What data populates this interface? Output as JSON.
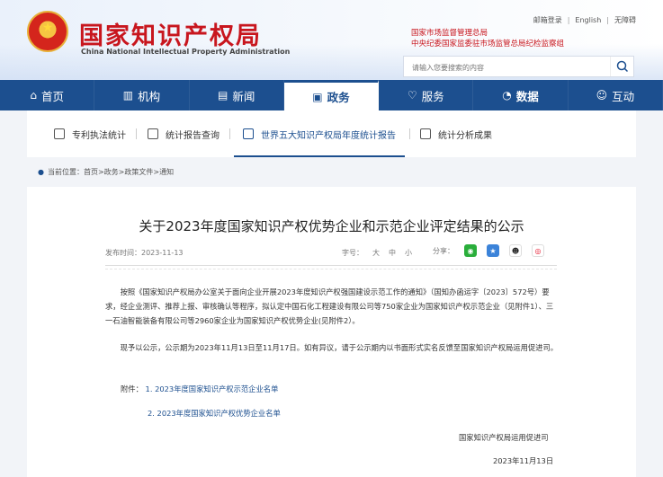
{
  "header": {
    "brand_cn": "国家知识产权局",
    "brand_en": "China National Intellectual Property Administration",
    "top_links": [
      "邮箱登录",
      "English",
      "无障碍"
    ],
    "org_links": [
      "国家市场监督管理总局",
      "中央纪委国家监委驻市场监管总局纪检监察组"
    ],
    "search_placeholder": "请输入您要搜索的内容"
  },
  "nav": [
    {
      "label": "首页",
      "icon": "home-icon"
    },
    {
      "label": "机构",
      "icon": "building-icon"
    },
    {
      "label": "新闻",
      "icon": "news-icon"
    },
    {
      "label": "政务",
      "icon": "document-icon",
      "active": true
    },
    {
      "label": "服务",
      "icon": "service-icon"
    },
    {
      "label": "数据",
      "icon": "chart-icon"
    },
    {
      "label": "互动",
      "icon": "interaction-icon"
    }
  ],
  "subnav": [
    {
      "label": "专利执法统计"
    },
    {
      "label": "统计报告查询"
    },
    {
      "label": "世界五大知识产权局年度统计报告",
      "active": true
    },
    {
      "label": "统计分析成果"
    }
  ],
  "breadcrumb": "当前位置：首页>政务>政策文件>通知",
  "article": {
    "title": "关于2023年度国家知识产权优势企业和示范企业评定结果的公示",
    "publish_label": "发布时间：",
    "publish_date": "2023-11-13",
    "fontsize_label": "字号：",
    "fontsizes": [
      "大",
      "中",
      "小"
    ],
    "share_label": "分享：",
    "para1": "按照《国家知识产权局办公室关于面向企业开展2023年度知识产权强国建设示范工作的通知》（国知办函运字〔2023〕572号）要求，经企业测评、推荐上报、审核确认等程序，拟认定中国石化工程建设有限公司等750家企业为国家知识产权示范企业（见附件1）、三一石油智能装备有限公司等2960家企业为国家知识产权优势企业(见附件2）。",
    "para2": "现予以公示，公示期为2023年11月13日至11月17日。如有异议，请于公示期内以书面形式实名反馈至国家知识产权局运用促进司。",
    "attachments_label": "附件：",
    "attachments": [
      "1. 2023年度国家知识产权示范企业名单",
      "2. 2023年度国家知识产权优势企业名单"
    ],
    "signer": "国家知识产权局运用促进司",
    "sign_date": "2023年11月13日"
  },
  "colors": {
    "nav_blue": "#1c4f8f",
    "brand_red": "#c8161e"
  }
}
